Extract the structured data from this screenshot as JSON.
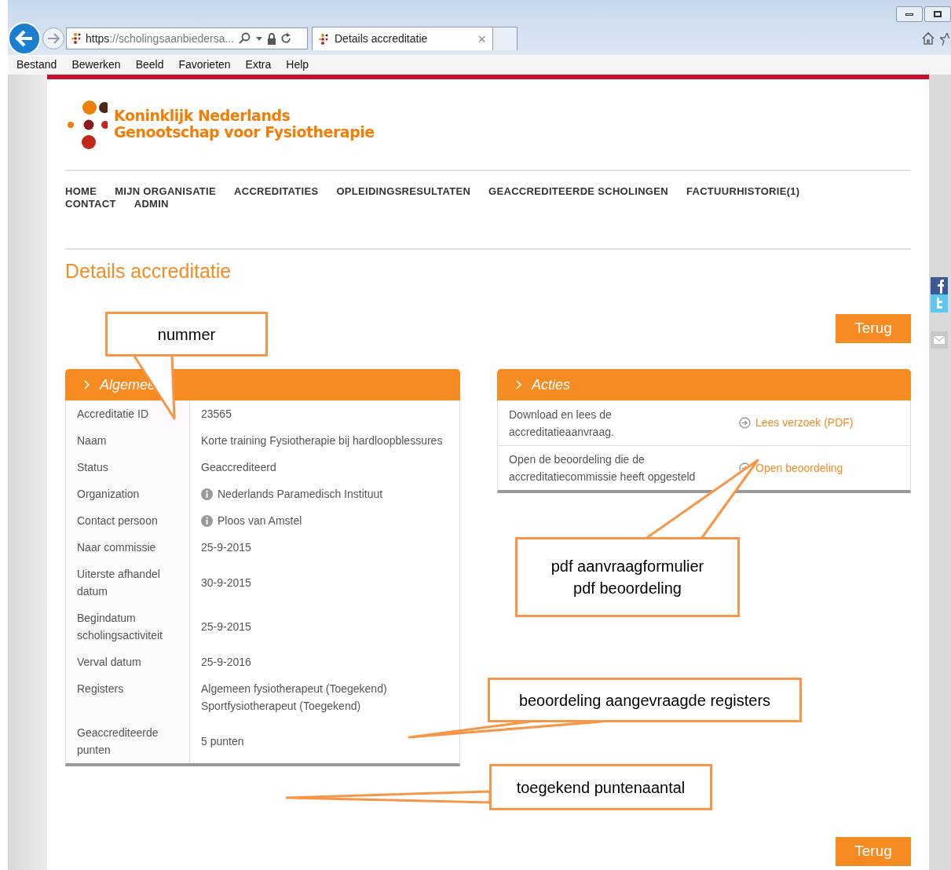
{
  "browser": {
    "url_scheme": "https",
    "url_rest": "://scholingsaanbiedersa...",
    "tab_title": "Details accreditatie",
    "tab_close": "×",
    "menu": [
      "Bestand",
      "Bewerken",
      "Beeld",
      "Favorieten",
      "Extra",
      "Help"
    ]
  },
  "site": {
    "logo_lines": [
      "Koninklijk Nederlands",
      "Genootschap voor Fysiotherapie"
    ],
    "nav": [
      "HOME",
      "MIJN ORGANISATIE",
      "ACCREDITATIES",
      "OPLEIDINGSRESULTATEN",
      "GEACCREDITEERDE SCHOLINGEN",
      "FACTUURHISTORIE(1)",
      "CONTACT",
      "ADMIN"
    ]
  },
  "page_title": "Details accreditatie",
  "back_buttons": [
    "Terug",
    "Terug"
  ],
  "general": {
    "title": "Algemee",
    "rows": [
      {
        "label": "Accreditatie ID",
        "lines": [
          "23565"
        ],
        "info": false
      },
      {
        "label": "Naam",
        "lines": [
          "Korte training Fysiotherapie bij hardloopblessures"
        ],
        "info": false
      },
      {
        "label": "Status",
        "lines": [
          "Geaccrediteerd"
        ],
        "info": false
      },
      {
        "label": "Organization",
        "lines": [
          "Nederlands Paramedisch Instituut"
        ],
        "info": true
      },
      {
        "label": "Contact persoon",
        "lines": [
          "Ploos van Amstel"
        ],
        "info": true
      },
      {
        "label": "Naar commissie",
        "lines": [
          "25-9-2015"
        ],
        "info": false
      },
      {
        "label": "Uiterste afhandel datum",
        "lines": [
          "30-9-2015"
        ],
        "info": false
      },
      {
        "label": "Begindatum scholingsactiviteit",
        "lines": [
          "25-9-2015"
        ],
        "info": false
      },
      {
        "label": "Verval datum",
        "lines": [
          "25-9-2016"
        ],
        "info": false
      },
      {
        "label": "Registers",
        "lines": [
          "Algemeen fysiotherapeut (Toegekend)",
          "Sportfysiotherapeut (Toegekend)"
        ],
        "info": false
      },
      {
        "label": "Geaccrediteerde punten",
        "lines": [
          "5 punten"
        ],
        "info": false
      }
    ]
  },
  "actions": {
    "title": "Acties",
    "rows": [
      {
        "description": "Download en lees de accreditatieaanvraag.",
        "link": "Lees verzoek (PDF)"
      },
      {
        "description": "Open de beoordeling die de accreditatiecommissie heeft opgesteld",
        "link": "Open beoordeling"
      }
    ]
  },
  "annotations": [
    {
      "lines": [
        "nummer"
      ]
    },
    {
      "lines": [
        "pdf aanvraagformulier",
        "pdf beoordeling"
      ]
    },
    {
      "lines": [
        "beoordeling aangevraagde registers"
      ]
    },
    {
      "lines": [
        "toegekend puntenaantal"
      ]
    }
  ]
}
